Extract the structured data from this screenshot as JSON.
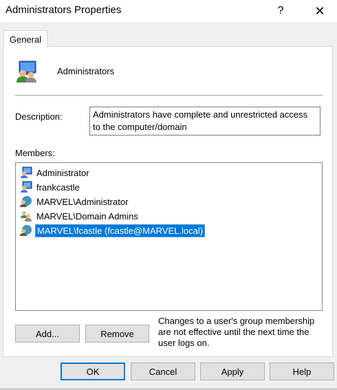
{
  "window": {
    "title": "Administrators Properties",
    "help_glyph": "?",
    "close_glyph": "✕"
  },
  "tabs": [
    {
      "label": "General"
    }
  ],
  "group": {
    "name": "Administrators",
    "icon": "group-icon"
  },
  "description": {
    "label": "Description:",
    "value": "Administrators have complete and unrestricted access to the computer/domain"
  },
  "members": {
    "label": "Members:",
    "items": [
      {
        "name": "Administrator",
        "icon": "local-user-icon",
        "selected": false
      },
      {
        "name": "frankcastle",
        "icon": "local-user-icon",
        "selected": false
      },
      {
        "name": "MARVEL\\Administrator",
        "icon": "domain-user-icon",
        "selected": false
      },
      {
        "name": "MARVEL\\Domain Admins",
        "icon": "domain-group-icon",
        "selected": false
      },
      {
        "name": "MARVEL\\fcastle (fcastle@MARVEL.local)",
        "icon": "domain-user-icon",
        "selected": true
      }
    ]
  },
  "actions": {
    "add_label": "Add...",
    "remove_label": "Remove"
  },
  "note": "Changes to a user's group membership are not effective until the next time the user logs on.",
  "footer": {
    "ok_label": "OK",
    "cancel_label": "Cancel",
    "apply_label": "Apply",
    "help_label": "Help"
  },
  "colors": {
    "selection": "#0078d7",
    "dialog_bg": "#f0f0f0",
    "button_bg": "#e1e1e1"
  }
}
